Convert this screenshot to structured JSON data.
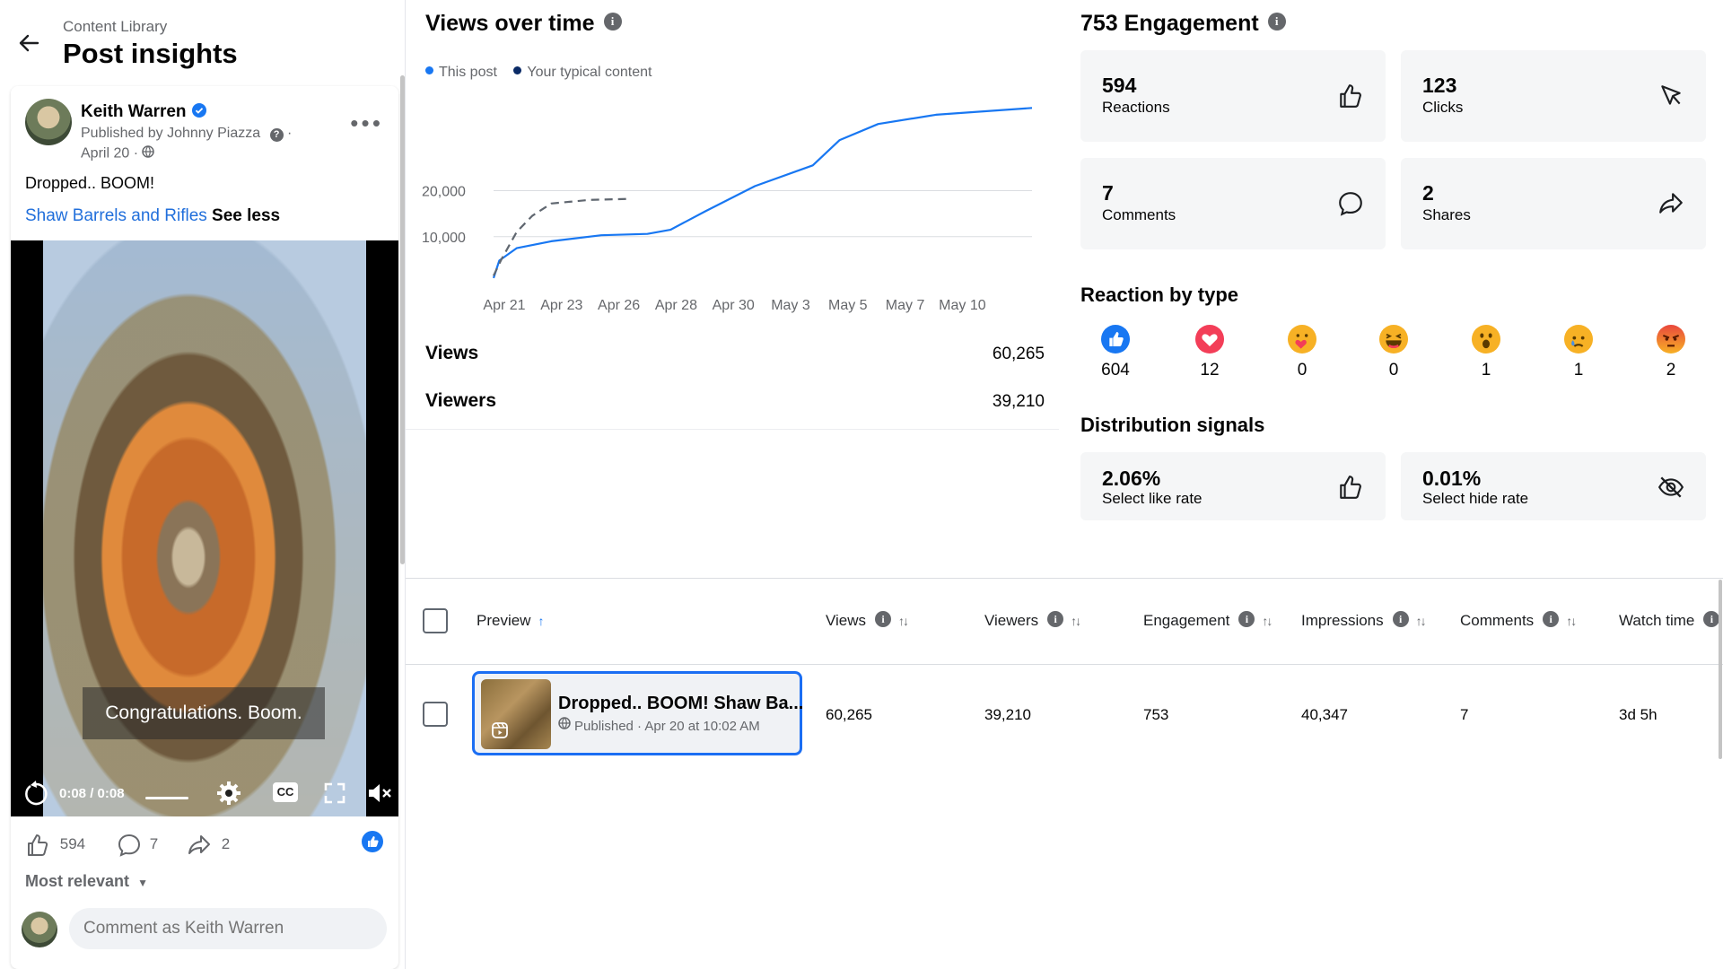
{
  "header": {
    "breadcrumb": "Content Library",
    "title": "Post insights"
  },
  "post": {
    "author": "Keith Warren",
    "published_by_prefix": "Published by",
    "published_by": "Johnny Piazza",
    "date": "April 20 ·",
    "text": "Dropped.. BOOM!",
    "link": "Shaw Barrels and Rifles",
    "see_less": "See less",
    "video": {
      "caption": "Congratulations. Boom.",
      "time": "0:08 / 0:08",
      "cc": "CC"
    },
    "reactions_count": "594",
    "comments_count": "7",
    "shares_count": "2",
    "sort_label": "Most relevant",
    "comment_placeholder": "Comment as Keith Warren"
  },
  "views_chart": {
    "title": "Views over time",
    "legend": [
      "This post",
      "Your typical content"
    ],
    "colors": {
      "this_post": "#1877f2",
      "typical": "#0a2a66",
      "typical_line": "#606770"
    },
    "stats": [
      {
        "label": "Views",
        "value": "60,265"
      },
      {
        "label": "Viewers",
        "value": "39,210"
      }
    ]
  },
  "chart_data": {
    "type": "line",
    "x": [
      "Apr 21",
      "Apr 23",
      "Apr 26",
      "Apr 28",
      "Apr 30",
      "May 3",
      "May 5",
      "May 7",
      "May 10"
    ],
    "yticks": [
      "20,000",
      "10,000"
    ],
    "ylim": [
      0,
      30000
    ],
    "grid": true,
    "series": [
      {
        "name": "This post",
        "style": "solid",
        "points": [
          [
            0,
            1000
          ],
          [
            0.3,
            4800
          ],
          [
            1.2,
            7500
          ],
          [
            3,
            9000
          ],
          [
            5.6,
            10300
          ],
          [
            8,
            10600
          ],
          [
            9.2,
            11500
          ],
          [
            11,
            15500
          ],
          [
            13.6,
            21000
          ],
          [
            16.6,
            25500
          ],
          [
            18,
            31000
          ],
          [
            20,
            34500
          ],
          [
            23,
            36500
          ],
          [
            28,
            38000
          ]
        ]
      },
      {
        "name": "Your typical content",
        "style": "dashed",
        "points": [
          [
            0,
            1500
          ],
          [
            0.4,
            5000
          ],
          [
            1.2,
            11000
          ],
          [
            2,
            14500
          ],
          [
            3,
            17200
          ],
          [
            5,
            18000
          ],
          [
            7,
            18200
          ]
        ]
      }
    ]
  },
  "engagement": {
    "title": "753 Engagement",
    "cards": [
      {
        "value": "594",
        "label": "Reactions",
        "icon": "thumbs-up-icon"
      },
      {
        "value": "123",
        "label": "Clicks",
        "icon": "cursor-icon"
      },
      {
        "value": "7",
        "label": "Comments",
        "icon": "comment-icon"
      },
      {
        "value": "2",
        "label": "Shares",
        "icon": "share-icon"
      }
    ]
  },
  "reactions": {
    "title": "Reaction by type",
    "items": [
      {
        "type": "like",
        "count": "604"
      },
      {
        "type": "love",
        "count": "12"
      },
      {
        "type": "care",
        "count": "0"
      },
      {
        "type": "haha",
        "count": "0"
      },
      {
        "type": "wow",
        "count": "1"
      },
      {
        "type": "sad",
        "count": "1"
      },
      {
        "type": "angry",
        "count": "2"
      }
    ]
  },
  "distribution": {
    "title": "Distribution signals",
    "cards": [
      {
        "value": "2.06%",
        "label": "Select like rate",
        "icon": "thumbs-up-icon"
      },
      {
        "value": "0.01%",
        "label": "Select hide rate",
        "icon": "eye-slash-icon"
      }
    ]
  },
  "table": {
    "headers": [
      "Preview",
      "Views",
      "Viewers",
      "Engagement",
      "Impressions",
      "Comments",
      "Watch time"
    ],
    "row": {
      "title": "Dropped.. BOOM! Shaw Ba...",
      "status": "Published · Apr 20 at 10:02 AM",
      "views": "60,265",
      "viewers": "39,210",
      "engagement": "753",
      "impressions": "40,347",
      "comments": "7",
      "watch_time": "3d 5h"
    }
  }
}
